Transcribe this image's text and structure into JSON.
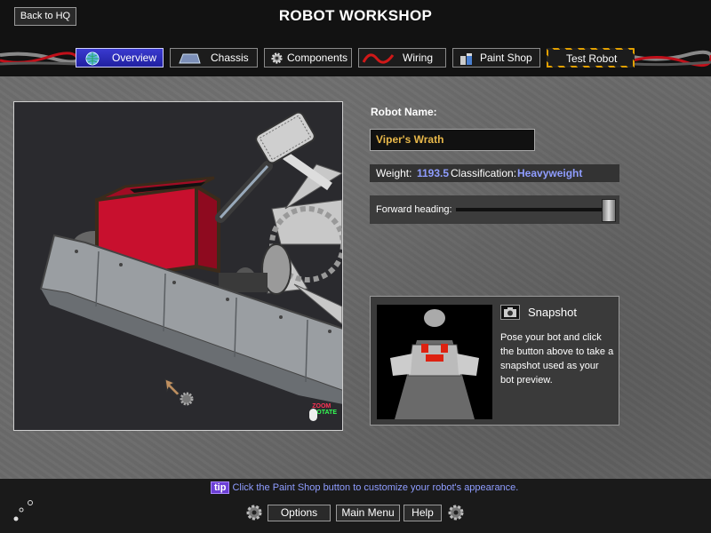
{
  "header": {
    "title": "ROBOT WORKSHOP",
    "back_label": "Back to HQ"
  },
  "tabs": [
    {
      "label": "Overview",
      "icon": "globe-icon",
      "active": true
    },
    {
      "label": "Chassis",
      "icon": "chassis-icon"
    },
    {
      "label": "Components",
      "icon": "gear-icon"
    },
    {
      "label": "Wiring",
      "icon": "wire-icon"
    },
    {
      "label": "Paint Shop",
      "icon": "paint-cans-icon"
    },
    {
      "label": "Test Robot",
      "icon": "hazard-stripes"
    }
  ],
  "viewport": {
    "zoom_hint": "ZOOM",
    "rotate_hint": "ROTATE"
  },
  "robot": {
    "name_label": "Robot Name:",
    "name": "Viper's Wrath",
    "weight_label": "Weight:",
    "weight": "1193.5",
    "classification_label": "Classification:",
    "classification": "Heavyweight"
  },
  "heading": {
    "label": "Forward heading:",
    "value": 1.0
  },
  "snapshot": {
    "title": "Snapshot",
    "description": "Pose your bot and click the button above to take a snapshot used as your bot preview."
  },
  "footer": {
    "tip_badge": "tip",
    "tip_text": "Click the Paint Shop button to customize your robot's appearance.",
    "buttons": [
      "Options",
      "Main Menu",
      "Help"
    ]
  },
  "colors": {
    "accent_blue": "#8f9dff",
    "name_text": "#e8b84a",
    "active_tab": "#2a2ac0",
    "robot_red": "#c8102e"
  }
}
